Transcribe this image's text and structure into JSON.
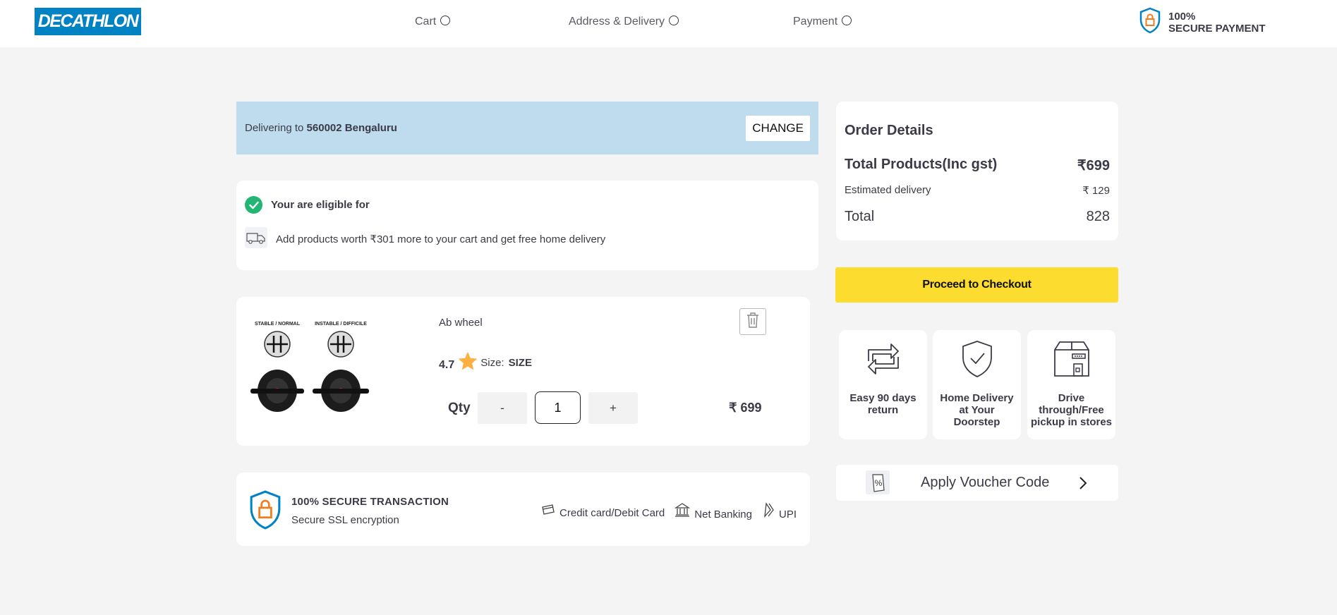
{
  "header": {
    "logo": "DECATHLON",
    "steps": [
      {
        "label": "Cart"
      },
      {
        "label": "Address & Delivery"
      },
      {
        "label": "Payment"
      }
    ],
    "secure_line1": "100%",
    "secure_line2": "SECURE PAYMENT"
  },
  "delivery": {
    "prefix": "Delivering to ",
    "location": "560002 Bengaluru",
    "change_label": "CHANGE"
  },
  "eligibility": {
    "title": "Your are eligible for",
    "message": "Add products worth ₹301 more to your cart and get free home delivery"
  },
  "product": {
    "image_label_left": "STABLE / NORMAL",
    "image_label_right": "INSTABLE / DIFFICILE",
    "name": "Ab wheel",
    "rating": "4.7",
    "size_label": "Size:",
    "size_value": "SIZE",
    "qty_label": "Qty",
    "qty_minus": "-",
    "qty_plus": "+",
    "qty_value": "1",
    "price": "₹ 699"
  },
  "secure_transaction": {
    "title": "100% SECURE TRANSACTION",
    "subtitle": "Secure SSL encryption",
    "methods": [
      "Credit card/Debit Card",
      "Net Banking",
      "UPI"
    ]
  },
  "order_details": {
    "title": "Order Details",
    "total_products_label": "Total Products(Inc gst)",
    "total_products_value": "₹699",
    "delivery_label": "Estimated delivery",
    "delivery_value": "₹ 129",
    "total_label": "Total",
    "total_value": "828"
  },
  "checkout_label": "Proceed to Checkout",
  "features": [
    {
      "label": "Easy 90 days return",
      "icon": "return-icon"
    },
    {
      "label": "Home Delivery at Your Doorstep",
      "icon": "shield-check-icon"
    },
    {
      "label": "Drive through/Free pickup in stores",
      "icon": "store-box-icon"
    }
  ],
  "voucher_label": "Apply Voucher Code",
  "colors": {
    "brand_blue": "#0082c3",
    "delivery_bar": "#bedcee",
    "checkout_yellow": "#fcdc2f",
    "success_green": "#22b573",
    "lock_orange": "#f07d1e"
  }
}
